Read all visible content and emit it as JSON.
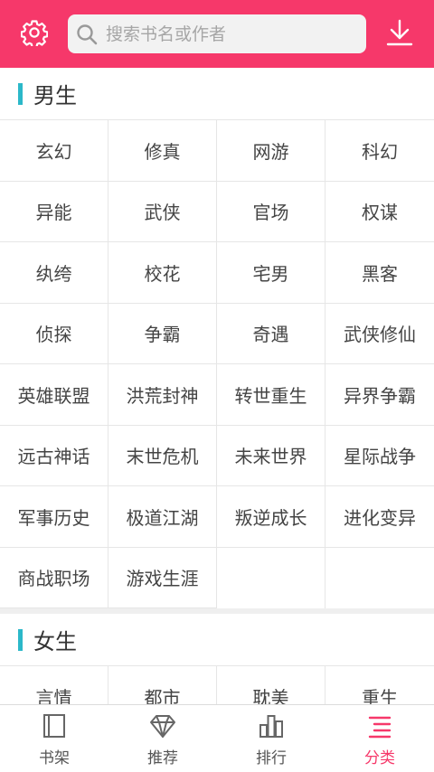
{
  "header": {
    "search_placeholder": "搜索书名或作者",
    "icons": [
      "gear-icon",
      "search-icon",
      "download-icon"
    ]
  },
  "sections": [
    {
      "title": "男生",
      "items": [
        "玄幻",
        "修真",
        "网游",
        "科幻",
        "异能",
        "武侠",
        "官场",
        "权谋",
        "纨绔",
        "校花",
        "宅男",
        "黑客",
        "侦探",
        "争霸",
        "奇遇",
        "武侠修仙",
        "英雄联盟",
        "洪荒封神",
        "转世重生",
        "异界争霸",
        "远古神话",
        "末世危机",
        "未来世界",
        "星际战争",
        "军事历史",
        "极道江湖",
        "叛逆成长",
        "进化变异",
        "商战职场",
        "游戏生涯"
      ]
    },
    {
      "title": "女生",
      "items": [
        "言情",
        "都市",
        "耽美",
        "重生"
      ]
    }
  ],
  "tabbar": {
    "tabs": [
      {
        "label": "书架",
        "icon": "bookshelf-icon"
      },
      {
        "label": "推荐",
        "icon": "diamond-icon"
      },
      {
        "label": "排行",
        "icon": "bar-chart-icon"
      },
      {
        "label": "分类",
        "icon": "category-list-icon",
        "active": true
      }
    ]
  },
  "colors": {
    "brand": "#f6386a",
    "section_accent": "#2bb8c9"
  }
}
